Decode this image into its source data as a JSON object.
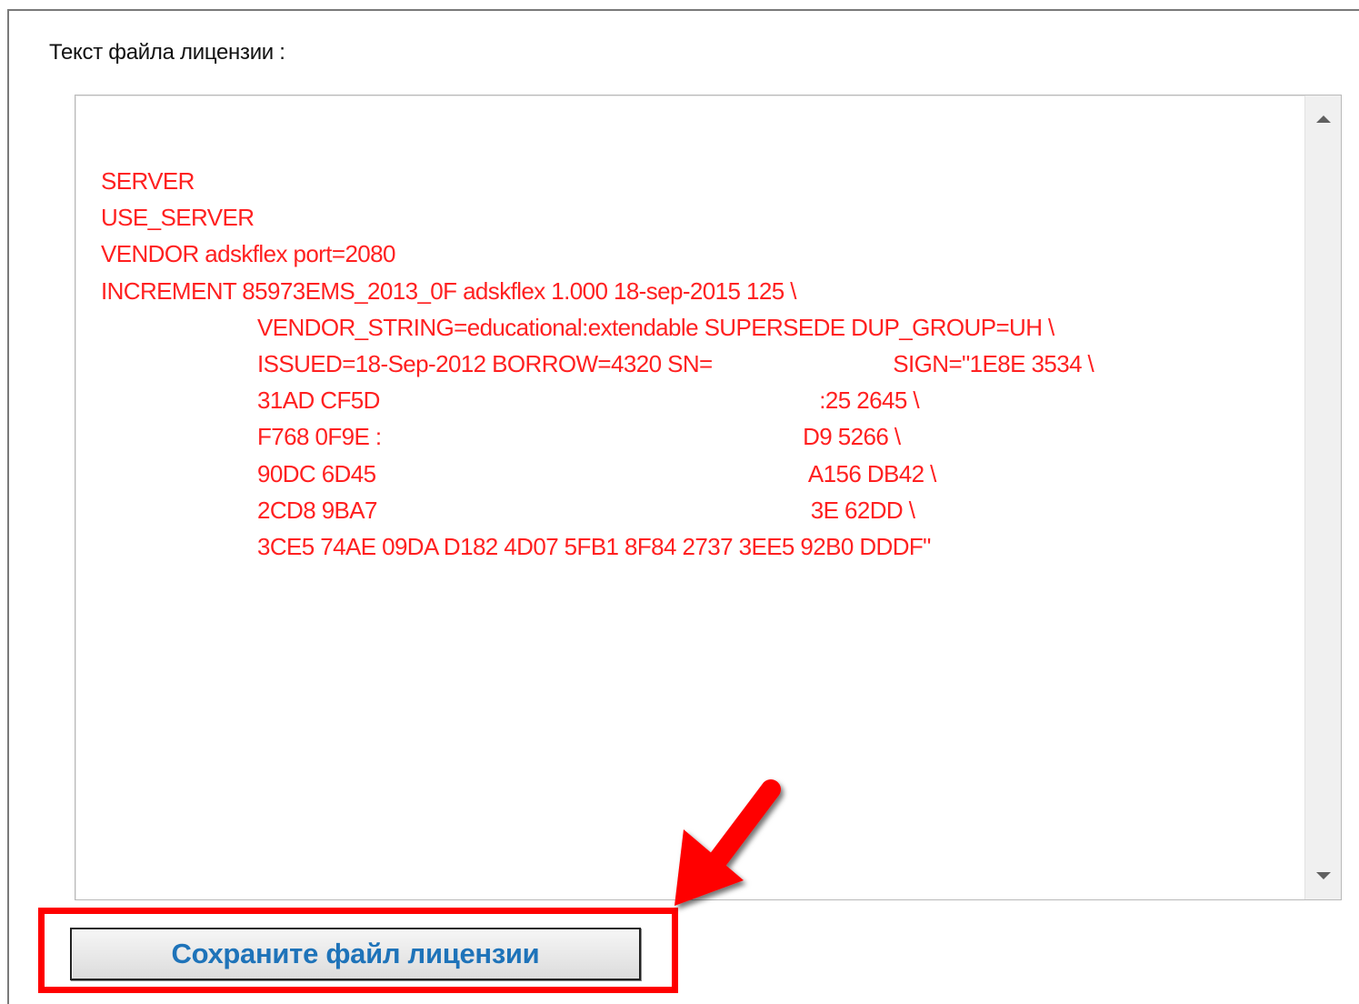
{
  "heading": "Текст файла лицензии :",
  "license": {
    "lines": [
      "SERVER",
      "USE_SERVER",
      "VENDOR adskflex port=2080",
      "INCREMENT 85973EMS_2013_0F adskflex 1.000 18-sep-2015 125 \\",
      "VENDOR_STRING=educational:extendable SUPERSEDE DUP_GROUP=UH \\",
      "ISSUED=18-Sep-2012 BORROW=4320 SN=                              SIGN=\"1E8E 3534 \\",
      "31AD CF5D                                                                         :25 2645 \\",
      "F768 0F9E :                                                                      D9 5266 \\",
      "90DC 6D45                                                                        A156 DB42 \\",
      "2CD8 9BA7                                                                        3E 62DD \\",
      "3CE5 74AE 09DA D182 4D07 5FB1 8F84 2737 3EE5 92B0 DDDF\""
    ],
    "color": "#ff2020"
  },
  "save_button": {
    "label": "Сохраните файл лицензии",
    "color": "#1e73b9"
  },
  "annotation": {
    "color": "#ff0000",
    "icon": "red-arrow-icon"
  }
}
